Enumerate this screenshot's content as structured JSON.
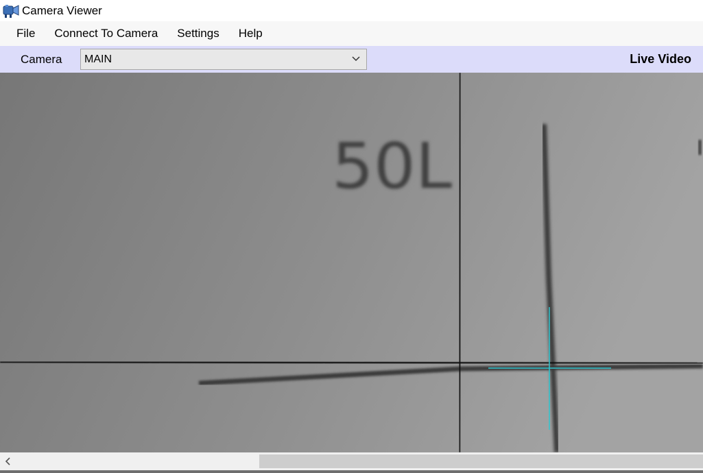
{
  "window": {
    "title": "Camera Viewer",
    "icon": "camera-viewer-app-icon"
  },
  "menu": {
    "items": [
      "File",
      "Connect To Camera",
      "Settings",
      "Help"
    ]
  },
  "camera_bar": {
    "label": "Camera",
    "selected_camera": "MAIN",
    "mode_label": "Live Video",
    "background": "#dcdcfa"
  },
  "video": {
    "overlay_text": "50L",
    "crosshair_color": "#2fc6d0"
  },
  "scrollbar": {
    "left_arrow_icon": "chevron-left-icon"
  }
}
